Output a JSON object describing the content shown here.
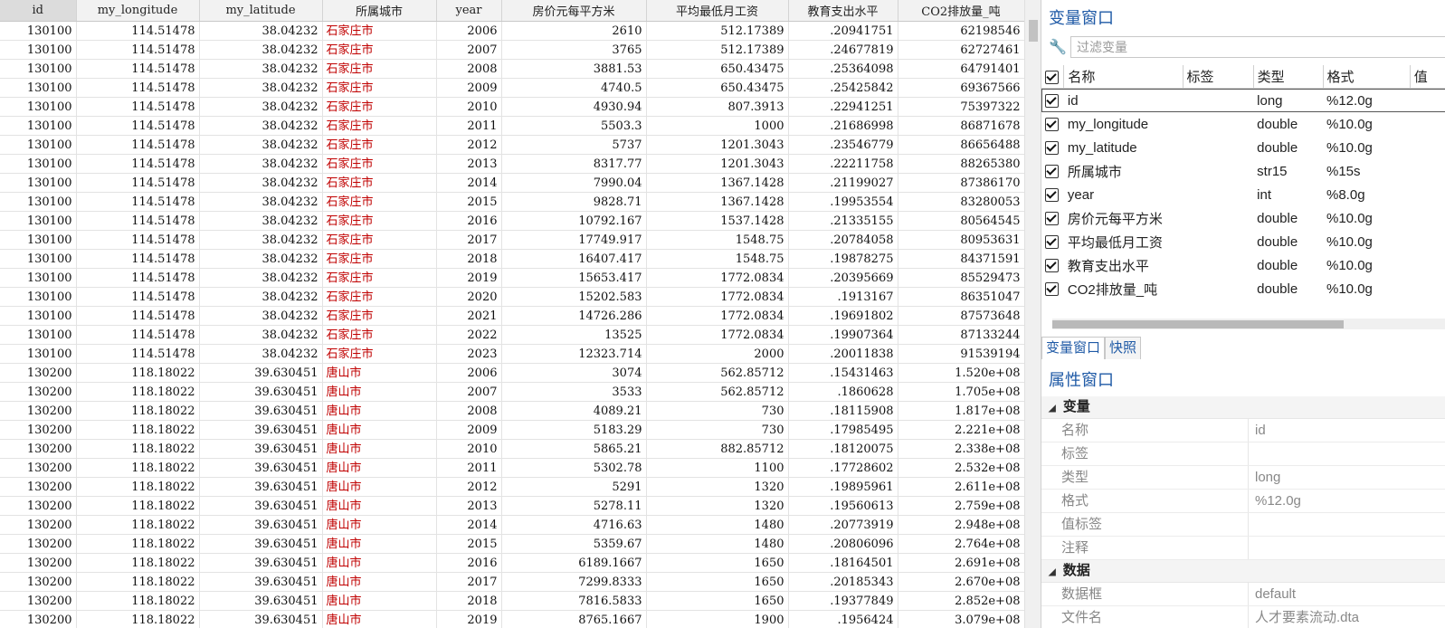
{
  "grid": {
    "columns": [
      "id",
      "my_longitude",
      "my_latitude",
      "所属城市",
      "year",
      "房价元每平方米",
      "平均最低月工资",
      "教育支出水平",
      "CO2排放量_吨"
    ],
    "rows": [
      [
        "130100",
        "114.51478",
        "38.04232",
        "石家庄市",
        "2006",
        "2610",
        "512.17389",
        ".20941751",
        "62198546"
      ],
      [
        "130100",
        "114.51478",
        "38.04232",
        "石家庄市",
        "2007",
        "3765",
        "512.17389",
        ".24677819",
        "62727461"
      ],
      [
        "130100",
        "114.51478",
        "38.04232",
        "石家庄市",
        "2008",
        "3881.53",
        "650.43475",
        ".25364098",
        "64791401"
      ],
      [
        "130100",
        "114.51478",
        "38.04232",
        "石家庄市",
        "2009",
        "4740.5",
        "650.43475",
        ".25425842",
        "69367566"
      ],
      [
        "130100",
        "114.51478",
        "38.04232",
        "石家庄市",
        "2010",
        "4930.94",
        "807.3913",
        ".22941251",
        "75397322"
      ],
      [
        "130100",
        "114.51478",
        "38.04232",
        "石家庄市",
        "2011",
        "5503.3",
        "1000",
        ".21686998",
        "86871678"
      ],
      [
        "130100",
        "114.51478",
        "38.04232",
        "石家庄市",
        "2012",
        "5737",
        "1201.3043",
        ".23546779",
        "86656488"
      ],
      [
        "130100",
        "114.51478",
        "38.04232",
        "石家庄市",
        "2013",
        "8317.77",
        "1201.3043",
        ".22211758",
        "88265380"
      ],
      [
        "130100",
        "114.51478",
        "38.04232",
        "石家庄市",
        "2014",
        "7990.04",
        "1367.1428",
        ".21199027",
        "87386170"
      ],
      [
        "130100",
        "114.51478",
        "38.04232",
        "石家庄市",
        "2015",
        "9828.71",
        "1367.1428",
        ".19953554",
        "83280053"
      ],
      [
        "130100",
        "114.51478",
        "38.04232",
        "石家庄市",
        "2016",
        "10792.167",
        "1537.1428",
        ".21335155",
        "80564545"
      ],
      [
        "130100",
        "114.51478",
        "38.04232",
        "石家庄市",
        "2017",
        "17749.917",
        "1548.75",
        ".20784058",
        "80953631"
      ],
      [
        "130100",
        "114.51478",
        "38.04232",
        "石家庄市",
        "2018",
        "16407.417",
        "1548.75",
        ".19878275",
        "84371591"
      ],
      [
        "130100",
        "114.51478",
        "38.04232",
        "石家庄市",
        "2019",
        "15653.417",
        "1772.0834",
        ".20395669",
        "85529473"
      ],
      [
        "130100",
        "114.51478",
        "38.04232",
        "石家庄市",
        "2020",
        "15202.583",
        "1772.0834",
        ".1913167",
        "86351047"
      ],
      [
        "130100",
        "114.51478",
        "38.04232",
        "石家庄市",
        "2021",
        "14726.286",
        "1772.0834",
        ".19691802",
        "87573648"
      ],
      [
        "130100",
        "114.51478",
        "38.04232",
        "石家庄市",
        "2022",
        "13525",
        "1772.0834",
        ".19907364",
        "87133244"
      ],
      [
        "130100",
        "114.51478",
        "38.04232",
        "石家庄市",
        "2023",
        "12323.714",
        "2000",
        ".20011838",
        "91539194"
      ],
      [
        "130200",
        "118.18022",
        "39.630451",
        "唐山市",
        "2006",
        "3074",
        "562.85712",
        ".15431463",
        "1.520e+08"
      ],
      [
        "130200",
        "118.18022",
        "39.630451",
        "唐山市",
        "2007",
        "3533",
        "562.85712",
        ".1860628",
        "1.705e+08"
      ],
      [
        "130200",
        "118.18022",
        "39.630451",
        "唐山市",
        "2008",
        "4089.21",
        "730",
        ".18115908",
        "1.817e+08"
      ],
      [
        "130200",
        "118.18022",
        "39.630451",
        "唐山市",
        "2009",
        "5183.29",
        "730",
        ".17985495",
        "2.221e+08"
      ],
      [
        "130200",
        "118.18022",
        "39.630451",
        "唐山市",
        "2010",
        "5865.21",
        "882.85712",
        ".18120075",
        "2.338e+08"
      ],
      [
        "130200",
        "118.18022",
        "39.630451",
        "唐山市",
        "2011",
        "5302.78",
        "1100",
        ".17728602",
        "2.532e+08"
      ],
      [
        "130200",
        "118.18022",
        "39.630451",
        "唐山市",
        "2012",
        "5291",
        "1320",
        ".19895961",
        "2.611e+08"
      ],
      [
        "130200",
        "118.18022",
        "39.630451",
        "唐山市",
        "2013",
        "5278.11",
        "1320",
        ".19560613",
        "2.759e+08"
      ],
      [
        "130200",
        "118.18022",
        "39.630451",
        "唐山市",
        "2014",
        "4716.63",
        "1480",
        ".20773919",
        "2.948e+08"
      ],
      [
        "130200",
        "118.18022",
        "39.630451",
        "唐山市",
        "2015",
        "5359.67",
        "1480",
        ".20806096",
        "2.764e+08"
      ],
      [
        "130200",
        "118.18022",
        "39.630451",
        "唐山市",
        "2016",
        "6189.1667",
        "1650",
        ".18164501",
        "2.691e+08"
      ],
      [
        "130200",
        "118.18022",
        "39.630451",
        "唐山市",
        "2017",
        "7299.8333",
        "1650",
        ".20185343",
        "2.670e+08"
      ],
      [
        "130200",
        "118.18022",
        "39.630451",
        "唐山市",
        "2018",
        "7816.5833",
        "1650",
        ".19377849",
        "2.852e+08"
      ],
      [
        "130200",
        "118.18022",
        "39.630451",
        "唐山市",
        "2019",
        "8765.1667",
        "1900",
        ".1956424",
        "3.079e+08"
      ]
    ]
  },
  "var_window": {
    "title": "变量窗口",
    "filter_placeholder": "过滤变量",
    "headers": [
      "名称",
      "标签",
      "类型",
      "格式",
      "值"
    ],
    "vars": [
      {
        "name": "id",
        "type": "long",
        "format": "%12.0g"
      },
      {
        "name": "my_longitude",
        "type": "double",
        "format": "%10.0g"
      },
      {
        "name": "my_latitude",
        "type": "double",
        "format": "%10.0g"
      },
      {
        "name": "所属城市",
        "type": "str15",
        "format": "%15s"
      },
      {
        "name": "year",
        "type": "int",
        "format": "%8.0g"
      },
      {
        "name": "房价元每平方米",
        "type": "double",
        "format": "%10.0g"
      },
      {
        "name": "平均最低月工资",
        "type": "double",
        "format": "%10.0g"
      },
      {
        "name": "教育支出水平",
        "type": "double",
        "format": "%10.0g"
      },
      {
        "name": "CO2排放量_吨",
        "type": "double",
        "format": "%10.0g"
      }
    ]
  },
  "tabs": [
    "变量窗口",
    "快照"
  ],
  "props": {
    "title": "属性窗口",
    "sections": [
      {
        "name": "变量",
        "rows": [
          {
            "k": "名称",
            "v": "id"
          },
          {
            "k": "标签",
            "v": ""
          },
          {
            "k": "类型",
            "v": "long"
          },
          {
            "k": "格式",
            "v": "%12.0g"
          },
          {
            "k": "值标签",
            "v": ""
          },
          {
            "k": "注释",
            "v": ""
          }
        ]
      },
      {
        "name": "数据",
        "rows": [
          {
            "k": "数据框",
            "v": "default"
          },
          {
            "k": "文件名",
            "v": "人才要素流动.dta"
          }
        ]
      }
    ]
  },
  "colors": {
    "string_cell": "#c00000",
    "panel_title": "#1f5aa6"
  }
}
